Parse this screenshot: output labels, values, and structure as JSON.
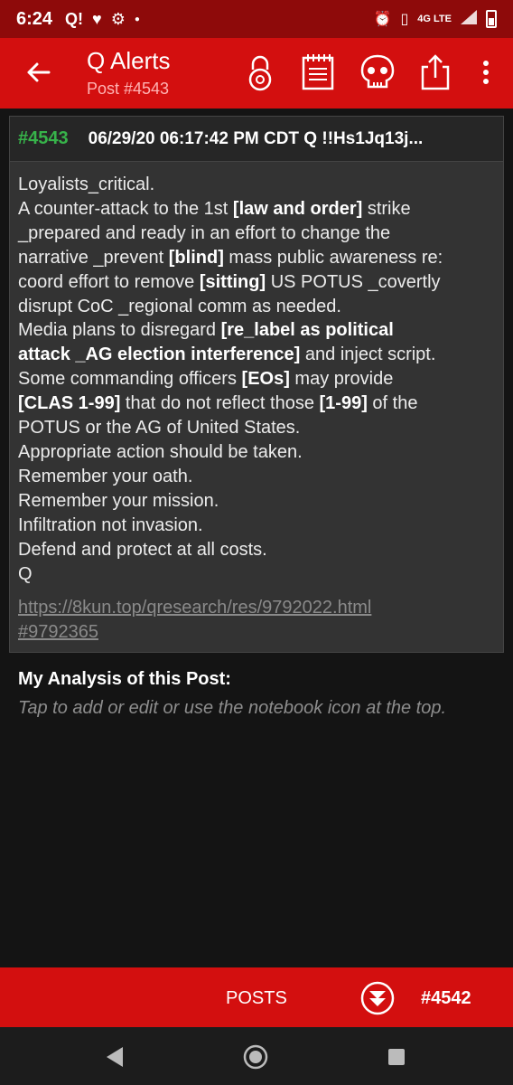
{
  "status_bar": {
    "time": "6:24",
    "carrier_icon": "Q!",
    "icons": [
      "heart-icon",
      "gear-icon",
      "dot-icon",
      "alarm-icon",
      "vibrate-icon",
      "signal-icon",
      "battery-icon"
    ],
    "network": "4G LTE"
  },
  "app_bar": {
    "title": "Q Alerts",
    "subtitle": "Post #4543",
    "icons": [
      "back-arrow-icon",
      "lock-icon",
      "notebook-icon",
      "skull-icon",
      "share-icon",
      "more-vert-icon"
    ]
  },
  "post": {
    "number": "#4543",
    "meta": "06/29/20 06:17:42 PM CDT Q !!Hs1Jq13j...",
    "lines": [
      [
        {
          "t": "Loyalists_critical."
        }
      ],
      [
        {
          "t": "A counter-attack to the 1st "
        },
        {
          "t": "[law and order]",
          "b": true
        },
        {
          "t": " strike"
        }
      ],
      [
        {
          "t": "_prepared and ready in an effort to change the"
        }
      ],
      [
        {
          "t": "narrative _prevent "
        },
        {
          "t": "[blind]",
          "b": true
        },
        {
          "t": " mass public awareness re:"
        }
      ],
      [
        {
          "t": "coord effort to remove "
        },
        {
          "t": "[sitting]",
          "b": true
        },
        {
          "t": " US POTUS _covertly"
        }
      ],
      [
        {
          "t": "disrupt CoC _regional comm as needed."
        }
      ],
      [
        {
          "t": "Media plans to disregard "
        },
        {
          "t": "[re_label as political",
          "b": true
        }
      ],
      [
        {
          "t": "attack _AG election interference]",
          "b": true
        },
        {
          "t": " and inject script."
        }
      ],
      [
        {
          "t": "Some commanding officers "
        },
        {
          "t": "[EOs]",
          "b": true
        },
        {
          "t": " may provide"
        }
      ],
      [
        {
          "t": "[CLAS 1-99]",
          "b": true
        },
        {
          "t": " that do not reflect those "
        },
        {
          "t": "[1-99]",
          "b": true
        },
        {
          "t": " of the"
        }
      ],
      [
        {
          "t": "POTUS or the AG of United States."
        }
      ],
      [
        {
          "t": "Appropriate action should be taken."
        }
      ],
      [
        {
          "t": "Remember your oath."
        }
      ],
      [
        {
          "t": "Remember your mission."
        }
      ],
      [
        {
          "t": "Infiltration not invasion."
        }
      ],
      [
        {
          "t": "Defend and protect at all costs."
        }
      ],
      [
        {
          "t": "Q"
        }
      ]
    ],
    "link_line1": "https://8kun.top/qresearch/res/9792022.html",
    "link_line2": "#9792365"
  },
  "analysis": {
    "title": "My Analysis of this Post:",
    "hint": "Tap to add or edit or use the notebook icon at the top."
  },
  "bottom_bar": {
    "posts_label": "POSTS",
    "next_label": "#4542"
  },
  "colors": {
    "status_bar": "#8e0a0a",
    "app_bar": "#d30f0f",
    "post_number": "#37b34a",
    "background": "#141414"
  }
}
